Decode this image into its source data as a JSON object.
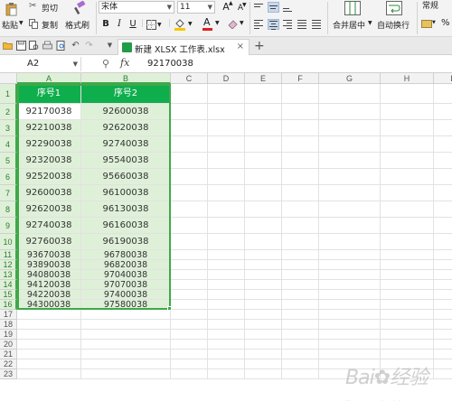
{
  "ribbon": {
    "clipboard": {
      "paste_label": "粘贴",
      "cut_label": "剪切",
      "copy_label": "复制",
      "format_painter_label": "格式刷"
    },
    "font": {
      "name": "宋体",
      "size": "11",
      "bold": "B",
      "italic": "I",
      "underline": "U",
      "increase_size": "A",
      "decrease_size": "A",
      "font_color_glyph": "A"
    },
    "merge_center_label": "合并居中",
    "wrap_text_label": "自动换行",
    "number_format": "常规",
    "percent_glyph": "%"
  },
  "tabs": {
    "document_title": "新建 XLSX 工作表.xlsx",
    "close_glyph": "×",
    "add_glyph": "+"
  },
  "formula_bar": {
    "cell_ref": "A2",
    "fx_label": "fx",
    "value": "92170038"
  },
  "sheet": {
    "columns": [
      "A",
      "B",
      "C",
      "D",
      "E",
      "F",
      "G",
      "H",
      "I"
    ],
    "rows": [
      "1",
      "2",
      "3",
      "4",
      "5",
      "6",
      "7",
      "8",
      "9",
      "10",
      "11",
      "12",
      "13",
      "14",
      "15",
      "16",
      "17",
      "18",
      "19",
      "20",
      "21",
      "22",
      "23"
    ],
    "headers": [
      "序号1",
      "序号2"
    ],
    "data": [
      [
        "92170038",
        "92600038"
      ],
      [
        "92210038",
        "92620038"
      ],
      [
        "92290038",
        "92740038"
      ],
      [
        "92320038",
        "95540038"
      ],
      [
        "92520038",
        "95660038"
      ],
      [
        "92600038",
        "96100038"
      ],
      [
        "92620038",
        "96130038"
      ],
      [
        "92740038",
        "96160038"
      ],
      [
        "92760038",
        "96190038"
      ],
      [
        "93670038",
        "96780038"
      ],
      [
        "93890038",
        "96820038"
      ],
      [
        "94080038",
        "97040038"
      ],
      [
        "94120038",
        "97070038"
      ],
      [
        "94220038",
        "97400038"
      ],
      [
        "94300038",
        "97580038"
      ]
    ],
    "active_cell": "A2"
  },
  "colors": {
    "header_fill": "#0fae4c",
    "selection_fill": "#dff0d8",
    "selection_border": "#3fa84a"
  }
}
